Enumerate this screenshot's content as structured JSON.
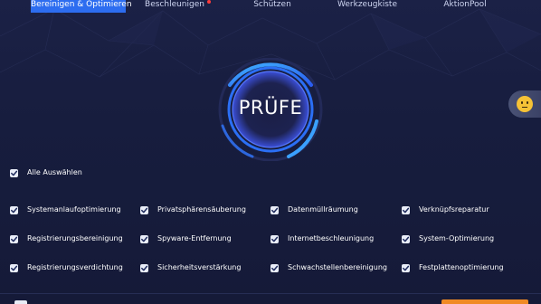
{
  "nav": {
    "tabs": [
      {
        "label": "Bereinigen & Optimieren",
        "active": true
      },
      {
        "label": "Beschleunigen",
        "badge": true
      },
      {
        "label": "Schützen"
      },
      {
        "label": "Werkzeugkiste"
      },
      {
        "label": "AktionPool"
      }
    ]
  },
  "scan": {
    "label": "PRÜFE"
  },
  "select_all": {
    "label": "Alle Auswählen",
    "checked": true
  },
  "options": [
    {
      "label": "Systemanlaufoptimierung",
      "checked": true
    },
    {
      "label": "Privatsphärensäuberung",
      "checked": true
    },
    {
      "label": "Datenmüllräumung",
      "checked": true
    },
    {
      "label": "Verknüpfsreparatur",
      "checked": true
    },
    {
      "label": "Registrierungsbereinigung",
      "checked": true
    },
    {
      "label": "Spyware-Entfernung",
      "checked": true
    },
    {
      "label": "Internetbeschleunigung",
      "checked": true
    },
    {
      "label": "System-Optimierung",
      "checked": true
    },
    {
      "label": "Registrierungsverdichtung",
      "checked": true
    },
    {
      "label": "Sicherheitsverstärkung",
      "checked": true
    },
    {
      "label": "Schwachstellenbereinigung",
      "checked": true
    },
    {
      "label": "Festplattenoptimierung",
      "checked": true
    }
  ],
  "colors": {
    "background": "#171d3d",
    "accent": "#2d6df0",
    "ring": "#2b8cff",
    "checkbox": "#e9edf8",
    "check": "#1e2a5c",
    "badge": "#ff3a3a",
    "action": "#f08a24",
    "assistant": "#f6c236"
  },
  "icons": {
    "assistant": "smiley-face-icon",
    "check": "checkmark-icon"
  }
}
